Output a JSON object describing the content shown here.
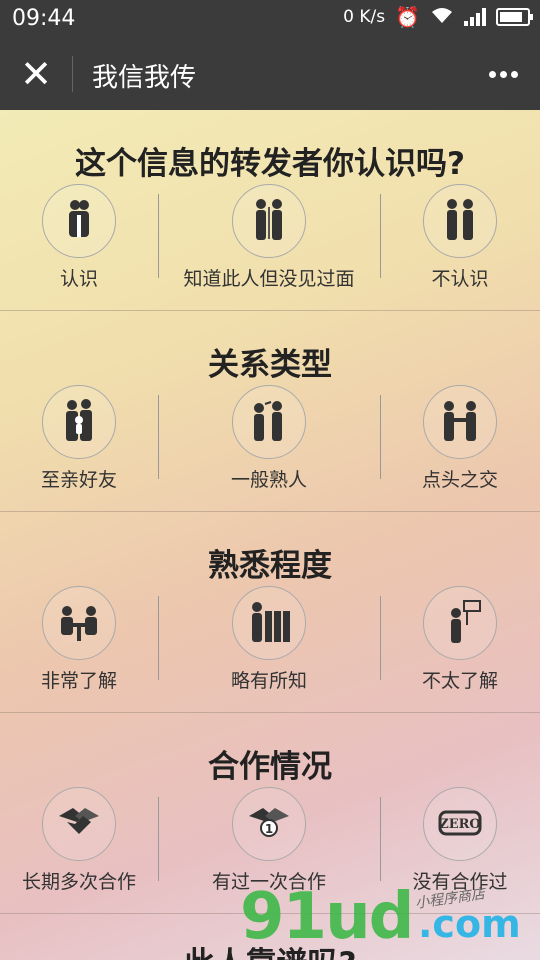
{
  "status": {
    "time": "09:44",
    "net_speed": "0 K/s"
  },
  "nav": {
    "title": "我信我传"
  },
  "sections": [
    {
      "title": "这个信息的转发者你认识吗?",
      "options": [
        "认识",
        "知道此人但没见过面",
        "不认识"
      ]
    },
    {
      "title": "关系类型",
      "options": [
        "至亲好友",
        "一般熟人",
        "点头之交"
      ]
    },
    {
      "title": "熟悉程度",
      "options": [
        "非常了解",
        "略有所知",
        "不太了解"
      ]
    },
    {
      "title": "合作情况",
      "options": [
        "长期多次合作",
        "有过一次合作",
        "没有合作过"
      ]
    }
  ],
  "next_section_title": "此人靠谱吗?",
  "icons": [
    [
      "couple-icon",
      "passing-people-icon",
      "two-men-icon"
    ],
    [
      "family-icon",
      "chatting-people-icon",
      "handshake-people-icon"
    ],
    [
      "people-at-table-icon",
      "man-with-cabinets-icon",
      "man-with-sign-icon"
    ],
    [
      "handshake-icon",
      "handshake-once-icon",
      "zero-badge-icon"
    ]
  ],
  "watermark": {
    "main": "91ud",
    "suffix": ".com",
    "tagline": "小程序商店"
  },
  "colors": {
    "bar": "#3b3b3b",
    "watermark_green": "#3fb849",
    "watermark_blue": "#35b6e5"
  }
}
